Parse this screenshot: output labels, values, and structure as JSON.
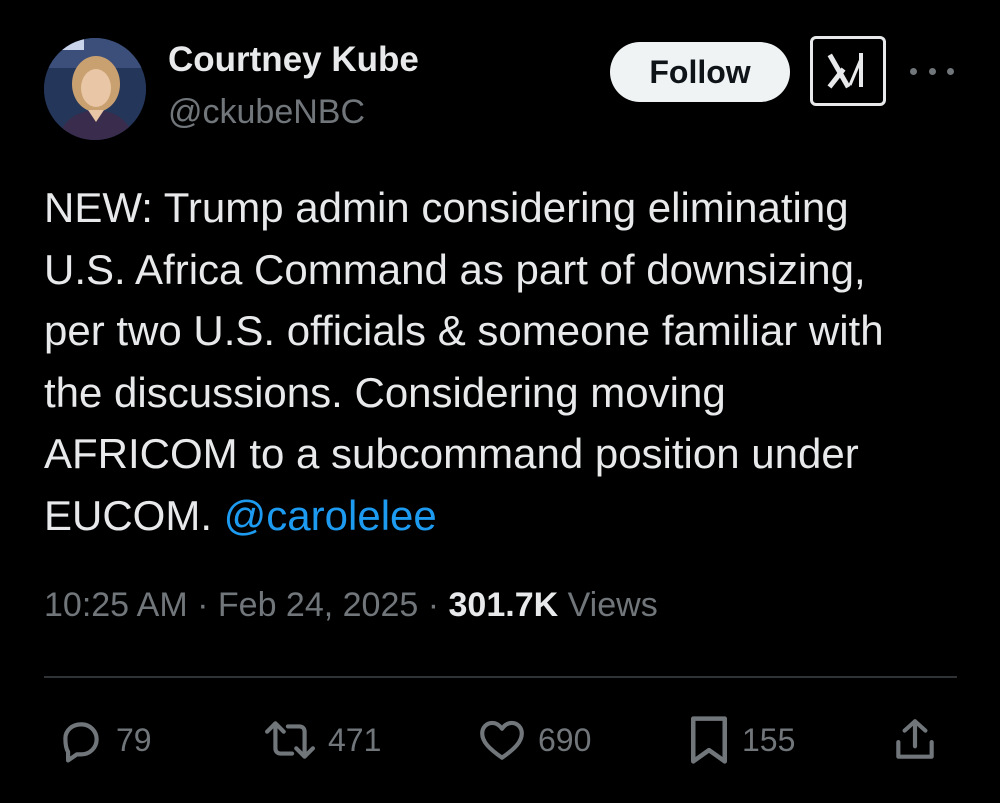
{
  "author": {
    "name": "Courtney Kube",
    "handle": "@ckubeNBC"
  },
  "header": {
    "follow_label": "Follow"
  },
  "tweet": {
    "lines": [
      "NEW: Trump admin considering eliminating",
      "U.S. Africa Command as part of downsizing,",
      "per two U.S. officials & someone familiar with",
      "the discussions. Considering moving",
      "AFRICOM to a subcommand position under"
    ],
    "last_line_prefix": "EUCOM. ",
    "mention": "@carolelee"
  },
  "meta": {
    "time": "10:25 AM",
    "separator": "·",
    "date": "Feb 24, 2025",
    "views_count": "301.7K",
    "views_label": "Views"
  },
  "actions": {
    "replies": "79",
    "reposts": "471",
    "likes": "690",
    "bookmarks": "155"
  },
  "icons": {
    "reply": "reply-icon",
    "repost": "repost-icon",
    "like": "heart-icon",
    "bookmark": "bookmark-icon",
    "share": "share-icon",
    "grok": "grok-icon",
    "more": "more-icon"
  },
  "colors": {
    "background": "#000000",
    "text": "#e7e9ea",
    "secondary": "#71767b",
    "mention": "#1d9bf0",
    "divider": "#2f3336",
    "follow_bg": "#eff3f4"
  }
}
